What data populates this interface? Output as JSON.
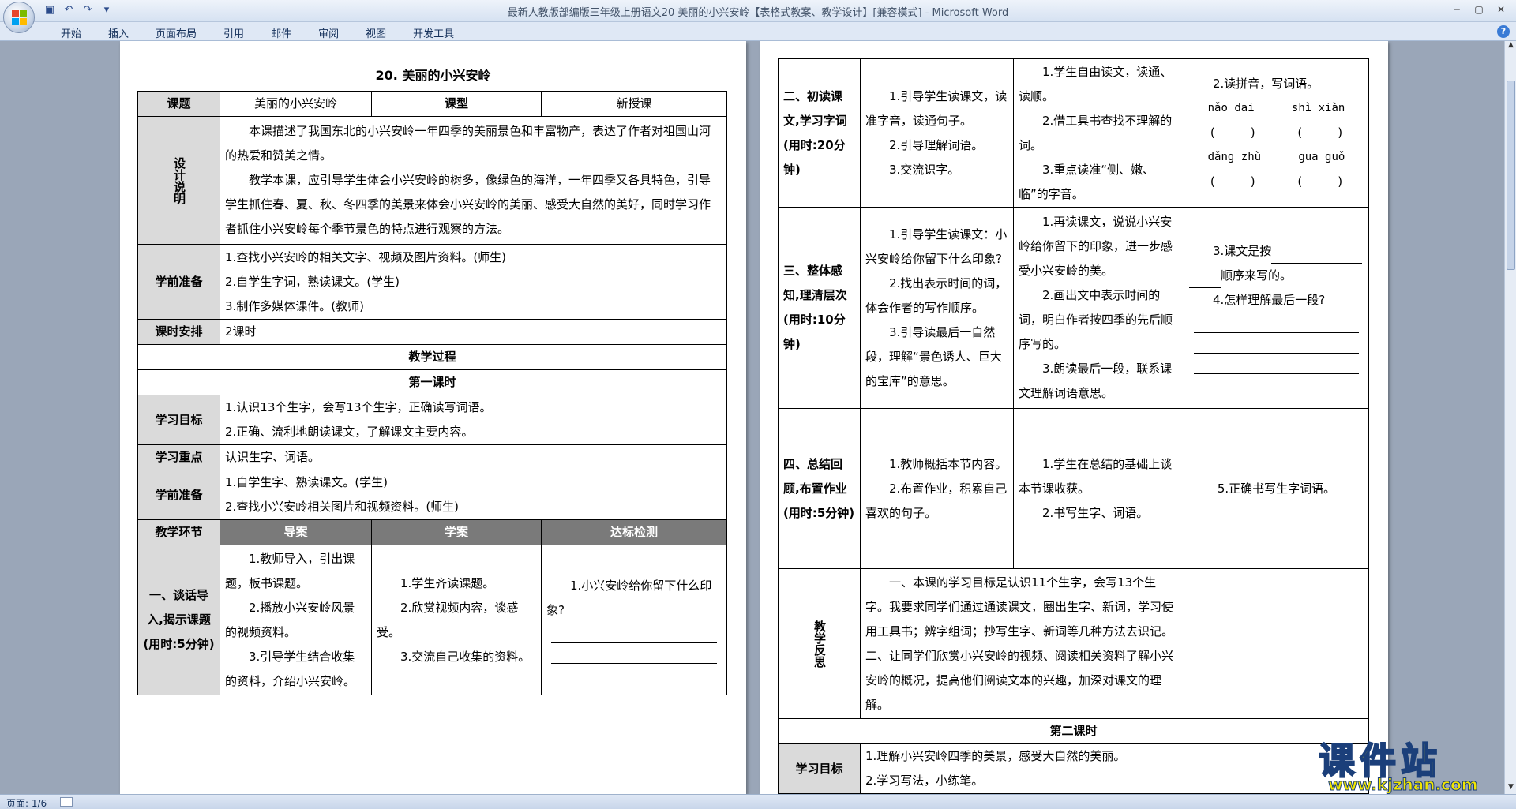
{
  "window": {
    "title": "最新人教版部编版三年级上册语文20 美丽的小兴安岭【表格式教案、教学设计】[兼容模式] - Microsoft Word"
  },
  "ribbon": {
    "tabs": [
      "开始",
      "插入",
      "页面布局",
      "引用",
      "邮件",
      "审阅",
      "视图",
      "开发工具"
    ]
  },
  "status": {
    "page": "页面: 1/6"
  },
  "page1": {
    "title": "20. 美丽的小兴安岭",
    "info": {
      "course_label": "课题",
      "course_value": "美丽的小兴安岭",
      "type_label": "课型",
      "type_value": "新授课"
    },
    "design": {
      "label": "设计说明",
      "p1": "本课描述了我国东北的小兴安岭一年四季的美丽景色和丰富物产，表达了作者对祖国山河的热爱和赞美之情。",
      "p2": "教学本课，应引导学生体会小兴安岭的树多，像绿色的海洋，一年四季又各具特色，引导学生抓住春、夏、秋、冬四季的美景来体会小兴安岭的美丽、感受大自然的美好，同时学习作者抓住小兴安岭每个季节景色的特点进行观察的方法。"
    },
    "prep1": {
      "label": "学前准备",
      "items": [
        "1.查找小兴安岭的相关文字、视频及图片资料。(师生)",
        "2.自学生字词，熟读课文。(学生)",
        "3.制作多媒体课件。(教师)"
      ]
    },
    "schedule": {
      "label": "课时安排",
      "value": "2课时"
    },
    "process_label": "教学过程",
    "lesson1_label": "第一课时",
    "goals": {
      "label": "学习目标",
      "items": [
        "1.认识13个生字，会写13个生字，正确读写词语。",
        "2.正确、流利地朗读课文，了解课文主要内容。"
      ]
    },
    "focus": {
      "label": "学习重点",
      "value": "认识生字、词语。"
    },
    "prep2": {
      "label": "学前准备",
      "items": [
        "1.自学生字、熟读课文。(学生)",
        "2.查找小兴安岭相关图片和视频资料。(师生)"
      ]
    },
    "columns": {
      "stage": "教学环节",
      "guide": "导案",
      "study": "学案",
      "check": "达标检测"
    },
    "stage1": {
      "label": "一、谈话导入,揭示课题(用时:5分钟)",
      "guide": [
        "1.教师导入，引出课题，板书课题。",
        "2.播放小兴安岭风景的视频资料。",
        "3.引导学生结合收集的资料，介绍小兴安岭。"
      ],
      "study": [
        "1.学生齐读课题。",
        "2.欣赏视频内容，谈感受。",
        "3.交流自己收集的资料。"
      ],
      "check": "1.小兴安岭给你留下什么印象?"
    }
  },
  "page2": {
    "stage2": {
      "label": "二、初读课文,学习字词(用时:20分钟)",
      "guide": [
        "1.引导学生读课文，读准字音，读通句子。",
        "2.引导理解词语。",
        "3.交流识字。"
      ],
      "study": [
        "1.学生自由读文，读通、读顺。",
        "2.借工具书查找不理解的词。",
        "3.重点读准“侧、嫩、临”的字音。"
      ],
      "check_title": "2.读拼音，写词语。",
      "pinyin": [
        "nǎo dai",
        "shì xiàn",
        "dǎng zhù",
        "guā guǒ"
      ]
    },
    "stage3": {
      "label": "三、整体感知,理清层次(用时:10分钟)",
      "guide": [
        "1.引导学生读课文：小兴安岭给你留下什么印象?",
        "2.找出表示时间的词，体会作者的写作顺序。",
        "3.引导读最后一自然段，理解“景色诱人、巨大的宝库”的意思。"
      ],
      "study": [
        "1.再读课文，说说小兴安岭给你留下的印象，进一步感受小兴安岭的美。",
        "2.画出文中表示时间的词，明白作者按四季的先后顺序写的。",
        "3.朗读最后一段，联系课文理解词语意思。"
      ],
      "check1": "3.课文是按",
      "check1b": "顺序来写的。",
      "check2": "4.怎样理解最后一段?"
    },
    "stage4": {
      "label": "四、总结回顾,布置作业(用时:5分钟)",
      "guide": [
        "1.教师概括本节内容。",
        "2.布置作业，积累自己喜欢的句子。"
      ],
      "study": [
        "1.学生在总结的基础上谈本节课收获。",
        "2.书写生字、词语。"
      ],
      "check": "5.正确书写生字词语。"
    },
    "reflection": {
      "label": "教学反思",
      "text": "一、本课的学习目标是认识11个生字，会写13个生字。我要求同学们通过通读课文，圈出生字、新词，学习使用工具书；辨字组词；抄写生字、新词等几种方法去识记。二、让同学们欣赏小兴安岭的视频、阅读相关资料了解小兴安岭的概况，提高他们阅读文本的兴趣，加深对课文的理解。"
    },
    "lesson2_label": "第二课时",
    "goals2": {
      "label": "学习目标",
      "items": [
        "1.理解小兴安岭四季的美景，感受大自然的美丽。",
        "2.学习写法，小练笔。"
      ]
    }
  },
  "watermark": {
    "cn": "课件站",
    "url": "www.kjzhan.com"
  }
}
